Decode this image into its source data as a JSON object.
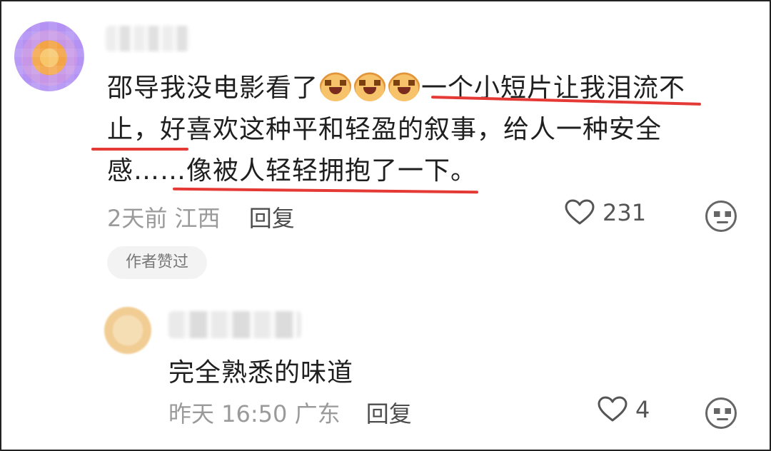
{
  "main_comment": {
    "lines": [
      {
        "before": "邵导我没电影看了",
        "after": "一个小短片让我泪流不"
      },
      {
        "text": "止，好喜欢这种平和轻盈的叙事，给人一种安全"
      },
      {
        "text": "感……像被人轻轻拥抱了一下。"
      }
    ],
    "time": "2天前",
    "location": "江西",
    "reply_label": "回复",
    "like_count": "231",
    "badge": "作者赞过"
  },
  "reply_comment": {
    "text": "完全熟悉的味道",
    "time": "昨天 16:50",
    "location": "广东",
    "reply_label": "回复",
    "like_count": "4"
  },
  "colors": {
    "underline": "#e53935",
    "meta": "#9a9a9a"
  }
}
